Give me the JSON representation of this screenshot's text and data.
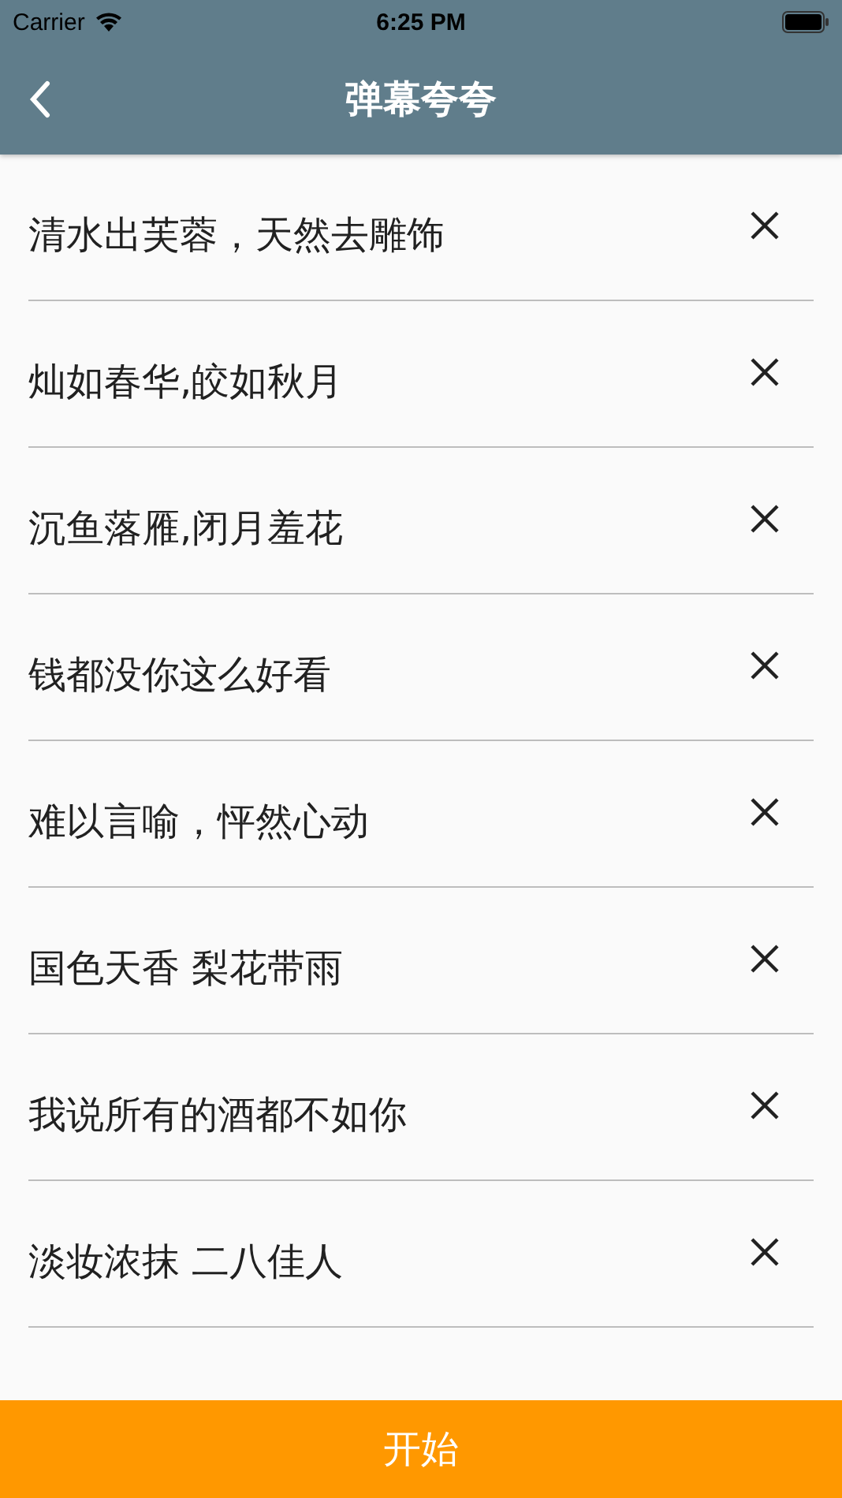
{
  "status_bar": {
    "carrier": "Carrier",
    "time": "6:25 PM"
  },
  "nav": {
    "title": "弹幕夸夸"
  },
  "phrases": [
    {
      "text": "清水出芙蓉，天然去雕饰"
    },
    {
      "text": "灿如春华,皎如秋月"
    },
    {
      "text": "沉鱼落雁,闭月羞花"
    },
    {
      "text": "钱都没你这么好看"
    },
    {
      "text": "难以言喻，怦然心动"
    },
    {
      "text": "国色天香 梨花带雨"
    },
    {
      "text": "我说所有的酒都不如你"
    },
    {
      "text": "淡妆浓抹 二八佳人"
    }
  ],
  "start_button": {
    "label": "开始"
  }
}
